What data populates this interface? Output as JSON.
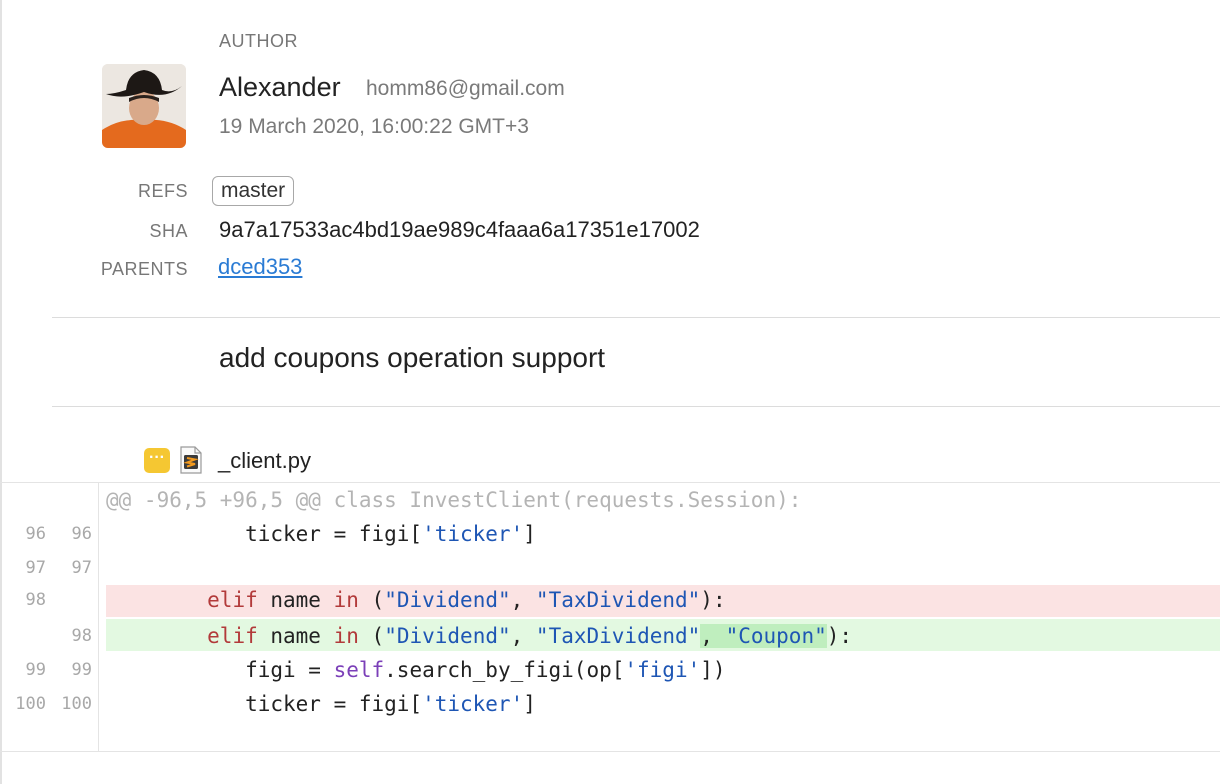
{
  "author": {
    "section_label": "AUTHOR",
    "name": "Alexander",
    "email": "homm86@gmail.com",
    "date": "19 March 2020, 16:00:22 GMT+3"
  },
  "meta": {
    "refs_label": "REFS",
    "ref": "master",
    "sha_label": "SHA",
    "sha": "9a7a17533ac4bd19ae989c4faaa6a17351e17002",
    "parents_label": "PARENTS",
    "parent": "dced353"
  },
  "commit": {
    "message": "add coupons operation support"
  },
  "file": {
    "menu_glyph": "···",
    "name": "_client.py",
    "icon": "sublime-file-icon"
  },
  "diff": {
    "hunk_header": "@@ -96,5 +96,5 @@ class InvestClient(requests.Session):",
    "lines": [
      {
        "old": "96",
        "new": "96",
        "type": "context"
      },
      {
        "old": "97",
        "new": "97",
        "type": "context"
      },
      {
        "old": "98",
        "new": "",
        "type": "removed"
      },
      {
        "old": "",
        "new": "98",
        "type": "added"
      },
      {
        "old": "99",
        "new": "99",
        "type": "context"
      },
      {
        "old": "100",
        "new": "100",
        "type": "context"
      }
    ]
  },
  "colors": {
    "link": "#2a7bd4",
    "removed_bg": "#fbe3e3",
    "added_bg": "#e3f9e1",
    "added_word_bg": "#bfeebe",
    "keyword": "#b23a3a",
    "string": "#1e56b4",
    "self": "#7b3fb8",
    "file_menu": "#f5c732"
  }
}
